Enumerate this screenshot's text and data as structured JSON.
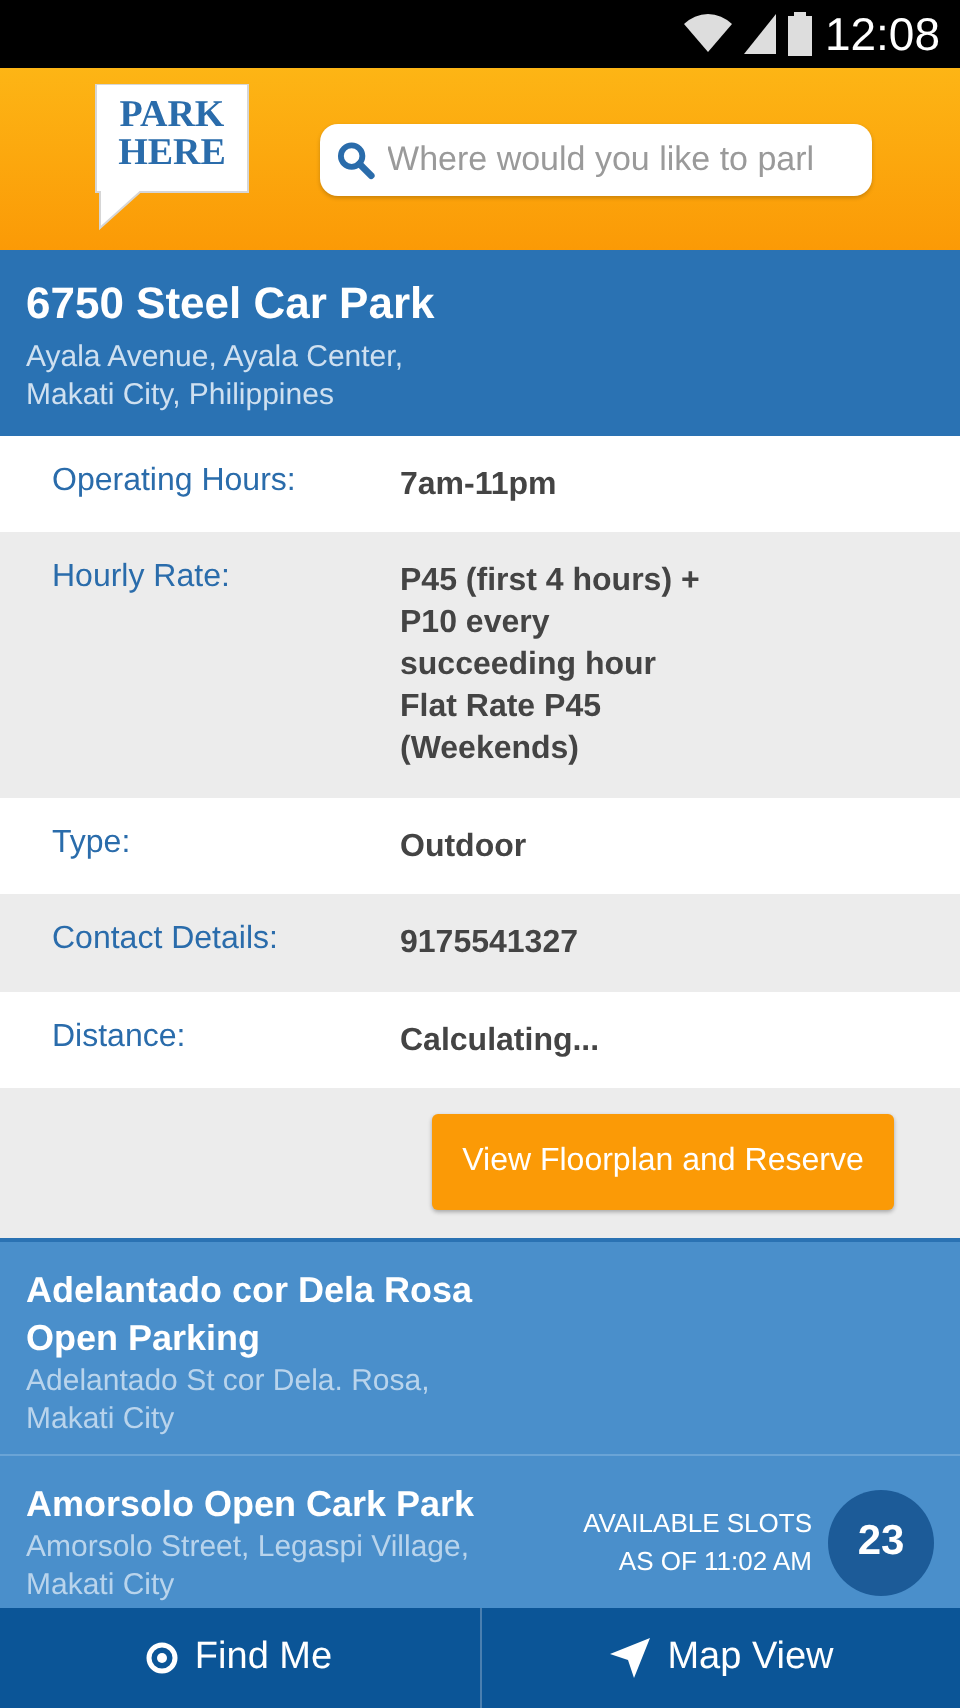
{
  "status_bar": {
    "time": "12:08"
  },
  "header": {
    "logo": [
      "PARK",
      "HERE"
    ],
    "search": {
      "placeholder": "Where would you like to parl"
    }
  },
  "car_park": {
    "name": "6750 Steel Car Park",
    "address": [
      "Ayala Avenue, Ayala Center,",
      "Makati City, Philippines"
    ]
  },
  "details": [
    {
      "label": "Operating Hours:",
      "value": [
        "7am-11pm"
      ]
    },
    {
      "label": "Hourly Rate:",
      "value": [
        "P45 (first 4 hours) +",
        "P10 every",
        "succeeding hour",
        "Flat Rate P45",
        "(Weekends)"
      ]
    },
    {
      "label": "Type:",
      "value": [
        "Outdoor"
      ]
    },
    {
      "label": "Contact Details:",
      "value": [
        "9175541327"
      ]
    },
    {
      "label": "Distance:",
      "value": [
        "Calculating..."
      ]
    }
  ],
  "reserve_button": "View Floorplan and Reserve",
  "nearby": [
    {
      "name": [
        "Adelantado cor Dela Rosa",
        "Open Parking"
      ],
      "address": [
        "Adelantado St cor Dela. Rosa,",
        "Makati City"
      ]
    },
    {
      "name": [
        "Amorsolo Open Cark Park"
      ],
      "address": [
        "Amorsolo Street, Legaspi Village,",
        "Makati City"
      ],
      "slots_label": [
        "AVAILABLE SLOTS",
        "AS OF 11:02 AM"
      ],
      "slots": "23"
    }
  ],
  "bottom_bar": [
    {
      "kind": "locate",
      "label": "Find Me"
    },
    {
      "kind": "map",
      "label": "Map View"
    }
  ]
}
